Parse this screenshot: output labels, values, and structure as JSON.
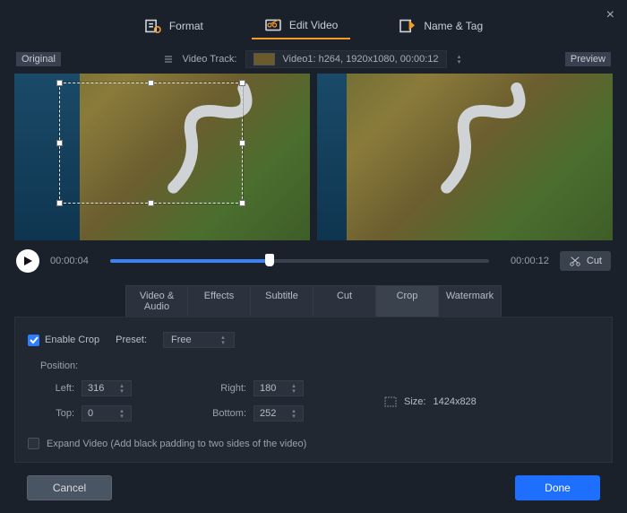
{
  "close_icon": "×",
  "topnav": {
    "format": "Format",
    "edit": "Edit Video",
    "name_tag": "Name & Tag"
  },
  "track": {
    "label": "Video Track:",
    "selected": "Video1: h264, 1920x1080, 00:00:12"
  },
  "labels": {
    "original": "Original",
    "preview": "Preview"
  },
  "playbar": {
    "current": "00:00:04",
    "total": "00:00:12",
    "cut": "Cut"
  },
  "subtabs": {
    "video_audio": "Video & Audio",
    "effects": "Effects",
    "subtitle": "Subtitle",
    "cut": "Cut",
    "crop": "Crop",
    "watermark": "Watermark"
  },
  "crop": {
    "enable": "Enable Crop",
    "preset_label": "Preset:",
    "preset_value": "Free",
    "position_label": "Position:",
    "left_label": "Left:",
    "left_value": "316",
    "top_label": "Top:",
    "top_value": "0",
    "right_label": "Right:",
    "right_value": "180",
    "bottom_label": "Bottom:",
    "bottom_value": "252",
    "size_label": "Size:",
    "size_value": "1424x828",
    "expand": "Expand Video (Add black padding to two sides of the video)"
  },
  "footer": {
    "cancel": "Cancel",
    "done": "Done"
  }
}
